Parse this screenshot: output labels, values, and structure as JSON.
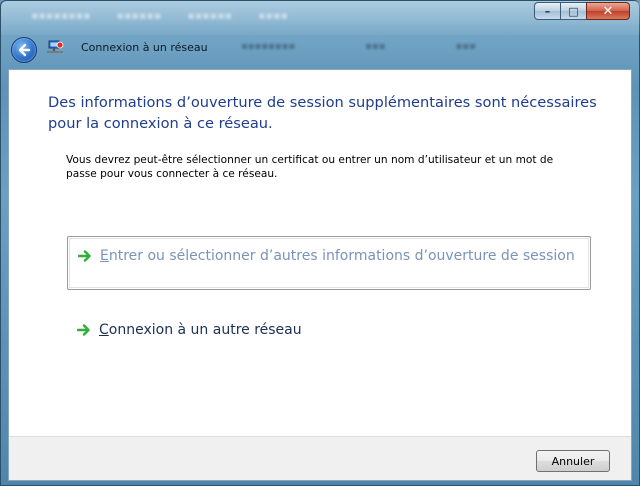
{
  "window": {
    "title": "Connexion à un réseau",
    "caption": {
      "minimize": "–",
      "maximize": "□",
      "close": "✕"
    }
  },
  "main_instruction": "Des informations d’ouverture de session supplémentaires sont nécessaires pour la connexion à ce réseau.",
  "description": "Vous devrez peut-être sélectionner un certificat ou entrer un nom d’utilisateur et un mot de passe pour vous connecter à ce réseau.",
  "options": [
    {
      "access_key": "E",
      "rest": "ntrer ou sélectionner d’autres informations d’ouverture de session",
      "enabled": false
    },
    {
      "access_key": "C",
      "rest": "onnexion à un autre réseau",
      "enabled": true
    }
  ],
  "footer": {
    "cancel_label": "Annuler"
  },
  "colors": {
    "instruction_text": "#1e3d8a",
    "disabled_link": "#7a93b9",
    "arrow_green": "#2fae3a"
  },
  "icons": [
    "back-arrow-icon",
    "network-icon",
    "green-arrow-icon"
  ]
}
